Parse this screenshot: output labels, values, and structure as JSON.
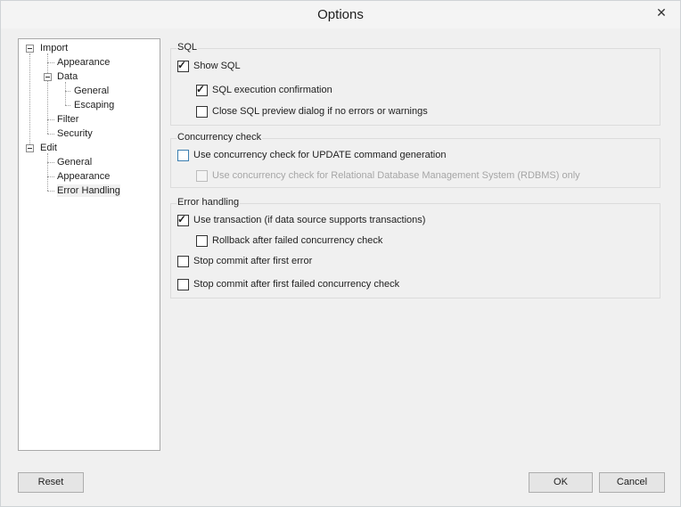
{
  "window": {
    "title": "Options",
    "close_glyph": "✕"
  },
  "tree": {
    "import": "Import",
    "import_appearance": "Appearance",
    "data": "Data",
    "data_general": "General",
    "data_escaping": "Escaping",
    "filter": "Filter",
    "security": "Security",
    "edit": "Edit",
    "edit_general": "General",
    "edit_appearance": "Appearance",
    "edit_error_handling": "Error Handling",
    "selected": "Error Handling"
  },
  "groups": {
    "sql": {
      "title": "SQL",
      "show_sql": {
        "label": "Show SQL",
        "checked": true
      },
      "sql_exec_confirmation": {
        "label": "SQL execution confirmation",
        "checked": true
      },
      "close_sql_preview": {
        "label": "Close SQL preview dialog if no errors or warnings",
        "checked": false
      }
    },
    "concurrency": {
      "title": "Concurrency check",
      "use_concurrency_update": {
        "label": "Use concurrency check for UPDATE command generation",
        "checked": false
      },
      "use_concurrency_rdbms": {
        "label": "Use concurrency check for Relational Database Management System (RDBMS) only",
        "checked": false,
        "disabled": true
      }
    },
    "error_handling": {
      "title": "Error handling",
      "use_transaction": {
        "label": "Use transaction (if data source supports transactions)",
        "checked": true
      },
      "rollback": {
        "label": "Rollback after failed concurrency check",
        "checked": false
      },
      "stop_first_error": {
        "label": "Stop commit after first error",
        "checked": false
      },
      "stop_first_concurrency": {
        "label": "Stop commit after first failed concurrency check",
        "checked": false
      }
    }
  },
  "buttons": {
    "reset": "Reset",
    "ok": "OK",
    "cancel": "Cancel"
  },
  "colors": {
    "focus_border": "#3c7fb1",
    "disabled_text": "#a6a6a6"
  }
}
